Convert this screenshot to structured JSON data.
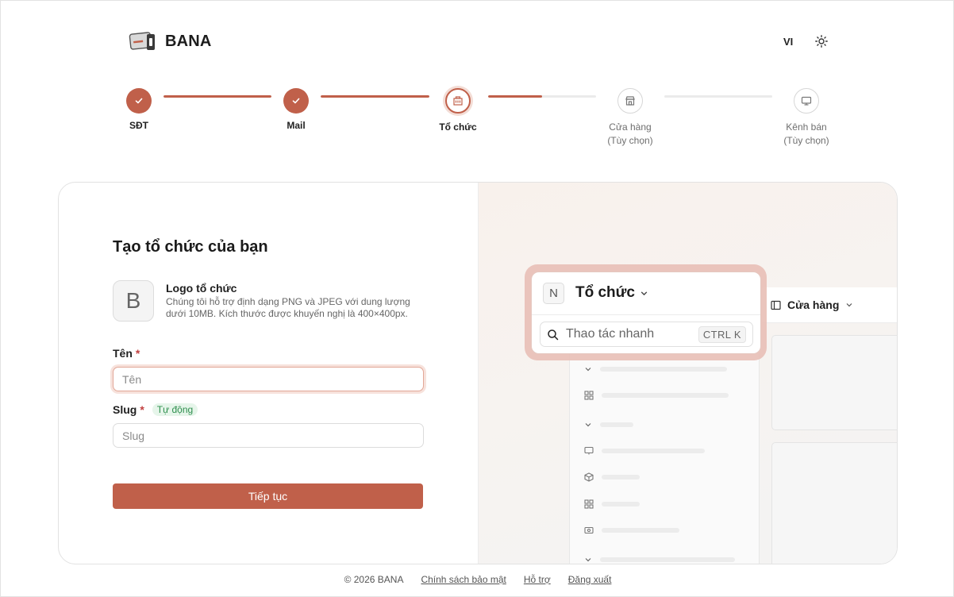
{
  "brand": {
    "name": "BANA"
  },
  "header": {
    "lang": "VI"
  },
  "stepper": {
    "steps": [
      {
        "label": "SĐT",
        "sub": ""
      },
      {
        "label": "Mail",
        "sub": ""
      },
      {
        "label": "Tổ chức",
        "sub": ""
      },
      {
        "label": "Cửa hàng",
        "sub": "(Tùy chọn)"
      },
      {
        "label": "Kênh bán",
        "sub": "(Tùy chọn)"
      }
    ],
    "progress": [
      1,
      1,
      0.5,
      0
    ]
  },
  "form": {
    "title": "Tạo tổ chức của bạn",
    "logo_letter": "B",
    "logo_title": "Logo tổ chức",
    "logo_desc": "Chúng tôi hỗ trợ định dạng PNG và JPEG với dung lượng dưới 10MB. Kích thước được khuyến nghị là 400×400px.",
    "name_label": "Tên",
    "name_placeholder": "Tên",
    "name_value": "",
    "slug_label": "Slug",
    "slug_badge": "Tự động",
    "slug_placeholder": "Slug",
    "slug_value": "",
    "required_mark": "*",
    "submit_label": "Tiếp tục"
  },
  "preview": {
    "org_letter": "N",
    "org_name": "Tổ chức",
    "quick_action": "Thao tác nhanh",
    "shortcut": "CTRL K",
    "store_label": "Cửa hàng"
  },
  "footer": {
    "copyright": "© 2026 BANA",
    "privacy": "Chính sách bảo mật",
    "support": "Hỗ trợ",
    "logout": "Đăng xuất"
  },
  "colors": {
    "accent": "#c0604a",
    "accent_soft": "#f3ddd6",
    "success": "#2f8f4e"
  }
}
